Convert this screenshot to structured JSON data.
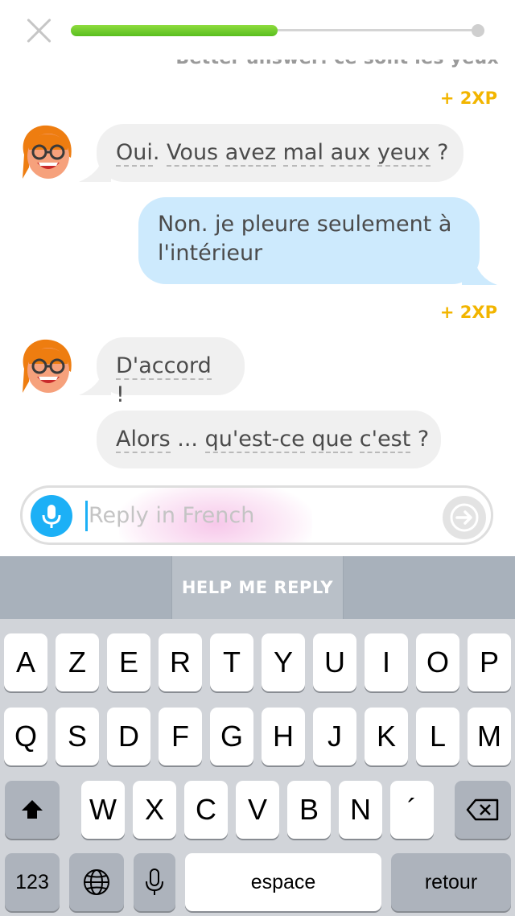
{
  "header": {
    "progress_fraction": 0.5
  },
  "chat": {
    "better_answer": "Better answer: ce sont les yeux",
    "xp_1": "+ 2XP",
    "msg_1_words": [
      "Oui",
      ". ",
      "Vous",
      " ",
      "avez",
      " ",
      "mal",
      " ",
      "aux",
      " ",
      "yeux",
      " ?"
    ],
    "msg_2": "Non. je pleure seulement à l'intérieur",
    "xp_2": "+ 2XP",
    "msg_3_word": "D'accord",
    "msg_3_punct": " !",
    "msg_4_words": [
      "Alors",
      " ... ",
      "qu'est-ce",
      " ",
      "que",
      " ",
      "c'est",
      " ?"
    ]
  },
  "reply": {
    "placeholder": "Reply in French"
  },
  "help": {
    "label": "HELP ME REPLY"
  },
  "keyboard": {
    "row1": [
      "A",
      "Z",
      "E",
      "R",
      "T",
      "Y",
      "U",
      "I",
      "O",
      "P"
    ],
    "row2": [
      "Q",
      "S",
      "D",
      "F",
      "G",
      "H",
      "J",
      "K",
      "L",
      "M"
    ],
    "row3": [
      "W",
      "X",
      "C",
      "V",
      "B",
      "N",
      "´"
    ],
    "numbers_label": "123",
    "space_label": "espace",
    "return_label": "retour"
  },
  "colors": {
    "progress": "#58cc02",
    "user_bubble": "#cdeafd",
    "xp": "#f2b500",
    "mic": "#1cb0f6"
  },
  "icons": [
    "close-icon",
    "mic-icon",
    "arrow-right-icon",
    "shift-icon",
    "backspace-icon",
    "globe-icon",
    "dictation-mic-icon"
  ]
}
